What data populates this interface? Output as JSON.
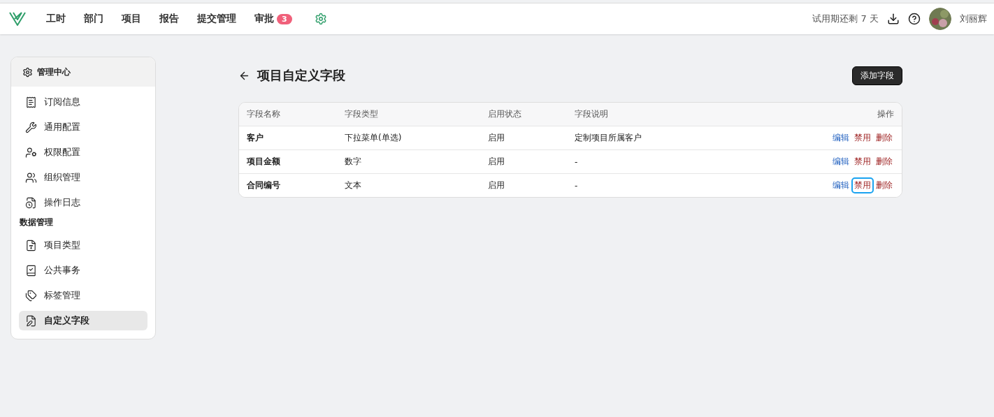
{
  "nav": {
    "items": [
      {
        "label": "工时",
        "selected": false
      },
      {
        "label": "部门",
        "selected": false
      },
      {
        "label": "项目",
        "selected": false
      },
      {
        "label": "报告",
        "selected": false
      },
      {
        "label": "提交管理",
        "selected": false
      },
      {
        "label": "审批",
        "selected": false,
        "badge": "3"
      }
    ],
    "trial": "试用期还剩 7 天",
    "user": "刘丽辉"
  },
  "sidebar": {
    "title": "管理中心",
    "sections": [
      {
        "items": [
          {
            "label": "订阅信息",
            "kind": "receipt",
            "selected": false
          },
          {
            "label": "通用配置",
            "kind": "wrench",
            "selected": false
          },
          {
            "label": "权限配置",
            "kind": "usercog",
            "selected": false
          },
          {
            "label": "组织管理",
            "kind": "users",
            "selected": false
          },
          {
            "label": "操作日志",
            "kind": "fileclock",
            "selected": false
          }
        ]
      },
      {
        "heading": "数据管理",
        "items": [
          {
            "label": "项目类型",
            "kind": "filetype",
            "selected": false
          },
          {
            "label": "公共事务",
            "kind": "bookcheck",
            "selected": false
          },
          {
            "label": "标签管理",
            "kind": "tags",
            "selected": false
          },
          {
            "label": "自定义字段",
            "kind": "filepen",
            "selected": true
          }
        ]
      }
    ]
  },
  "page": {
    "title": "项目自定义字段",
    "add_button": "添加字段"
  },
  "table": {
    "columns": [
      "字段名称",
      "字段类型",
      "启用状态",
      "字段说明",
      "操作"
    ],
    "rows": [
      {
        "cells": [
          "客户",
          "下拉菜单(单选)",
          "启用",
          "定制项目所属客户"
        ],
        "actions": [
          {
            "label": "编辑",
            "kind": "edit",
            "focused": false
          },
          {
            "label": "禁用",
            "kind": "danger",
            "focused": false
          },
          {
            "label": "删除",
            "kind": "danger",
            "focused": false
          }
        ]
      },
      {
        "cells": [
          "项目金额",
          "数字",
          "启用",
          "-"
        ],
        "actions": [
          {
            "label": "编辑",
            "kind": "edit",
            "focused": false
          },
          {
            "label": "禁用",
            "kind": "danger",
            "focused": false
          },
          {
            "label": "删除",
            "kind": "danger",
            "focused": false
          }
        ]
      },
      {
        "cells": [
          "合同编号",
          "文本",
          "启用",
          "-"
        ],
        "actions": [
          {
            "label": "编辑",
            "kind": "edit",
            "focused": false
          },
          {
            "label": "禁用",
            "kind": "danger",
            "focused": true
          },
          {
            "label": "删除",
            "kind": "danger",
            "focused": false
          }
        ]
      }
    ]
  }
}
